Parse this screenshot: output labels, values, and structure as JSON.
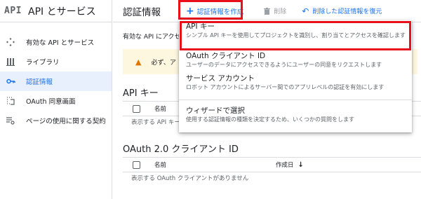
{
  "sidebar": {
    "logo": "API",
    "title": "API とサービス",
    "items": [
      {
        "label": "有効な API とサービス",
        "icon": "dashboard-diamond-icon"
      },
      {
        "label": "ライブラリ",
        "icon": "library-icon"
      },
      {
        "label": "認証情報",
        "icon": "key-icon",
        "active": true
      },
      {
        "label": "OAuth 同意画面",
        "icon": "consent-screen-icon"
      },
      {
        "label": "ページの使用に関する契約",
        "icon": "settings-list-icon"
      }
    ]
  },
  "toolbar": {
    "page_title": "認証情報",
    "create_label": "認証情報を作成",
    "delete_label": "削除",
    "restore_label": "削除した認証情報を復元"
  },
  "main": {
    "intro": "有効な API にアクセ",
    "warning": "必ず、ア",
    "api_keys": {
      "title": "API キー",
      "col_name": "名前",
      "empty": "表示する API キー"
    },
    "oauth": {
      "title": "OAuth 2.0 クライアント ID",
      "col_name": "名前",
      "col_created": "作成日",
      "empty": "表示する OAuth クライアントがありません"
    }
  },
  "menu": {
    "items": [
      {
        "label": "API キー",
        "desc": "シンプル API キーを使用してプロジェクトを識別し、割り当てとアクセスを確認します"
      },
      {
        "label": "OAuth クライアント ID",
        "desc": "ユーザーのデータにアクセスできるようにユーザーの同意をリクエストします"
      },
      {
        "label": "サービス アカウント",
        "desc": "ロボット アカウントによるサーバー間でのアプリレベルの認証を有効にします"
      },
      {
        "label": "ウィザードで選択",
        "desc": "使用する認証情報の種類を決定するため、いくつかの質問をします"
      }
    ]
  },
  "colors": {
    "accent": "#1a73e8",
    "highlight": "#e8111b",
    "warning_bg": "#fef7e0",
    "active_bg": "#e8f0fe"
  }
}
